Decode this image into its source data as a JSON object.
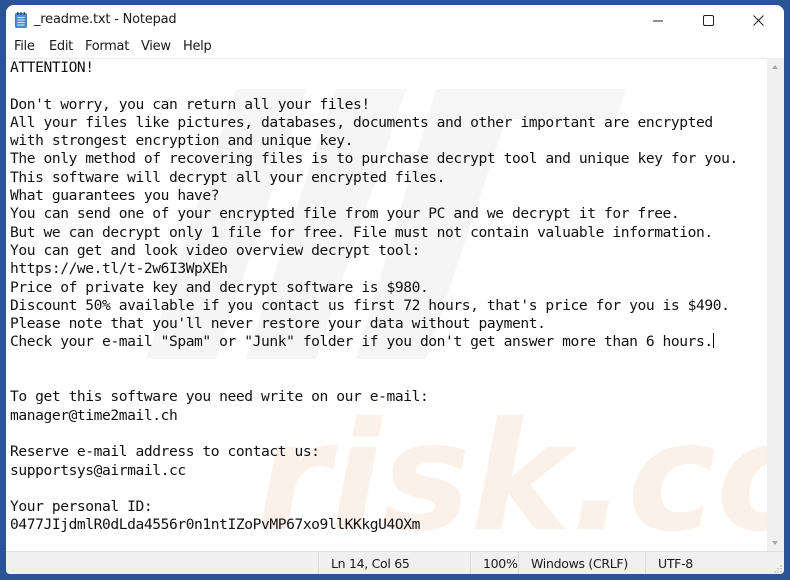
{
  "window": {
    "title": "_readme.txt - Notepad",
    "icon": "notepad-icon",
    "controls": {
      "minimize": "minimize-icon",
      "maximize": "maximize-icon",
      "close": "close-icon"
    }
  },
  "menu": {
    "items": [
      "File",
      "Edit",
      "Format",
      "View",
      "Help"
    ]
  },
  "document": {
    "lines": [
      "ATTENTION!",
      "",
      "Don't worry, you can return all your files!",
      "All your files like pictures, databases, documents and other important are encrypted",
      "with strongest encryption and unique key.",
      "The only method of recovering files is to purchase decrypt tool and unique key for you.",
      "This software will decrypt all your encrypted files.",
      "What guarantees you have?",
      "You can send one of your encrypted file from your PC and we decrypt it for free.",
      "But we can decrypt only 1 file for free. File must not contain valuable information.",
      "You can get and look video overview decrypt tool:",
      "https://we.tl/t-2w6I3WpXEh",
      "Price of private key and decrypt software is $980.",
      "Discount 50% available if you contact us first 72 hours, that's price for you is $490.",
      "Please note that you'll never restore your data without payment.",
      "Check your e-mail \"Spam\" or \"Junk\" folder if you don't get answer more than 6 hours.",
      "",
      "",
      "To get this software you need write on our e-mail:",
      "manager@time2mail.ch",
      "",
      "Reserve e-mail address to contact us:",
      "supportsys@airmail.cc",
      "",
      "Your personal ID:",
      "0477JIjdmlR0dLda4556r0n1ntIZoPvMP67xo9llKKkgU4OXm"
    ],
    "caret_line": 15
  },
  "watermark": {
    "text": "risk.com"
  },
  "statusbar": {
    "position": "Ln 14, Col 65",
    "zoom": "100%",
    "line_ending": "Windows (CRLF)",
    "encoding": "UTF-8"
  },
  "colors": {
    "desktop": "#2a5592",
    "statusbar_bg": "#f0f0f0",
    "text": "#111111"
  }
}
